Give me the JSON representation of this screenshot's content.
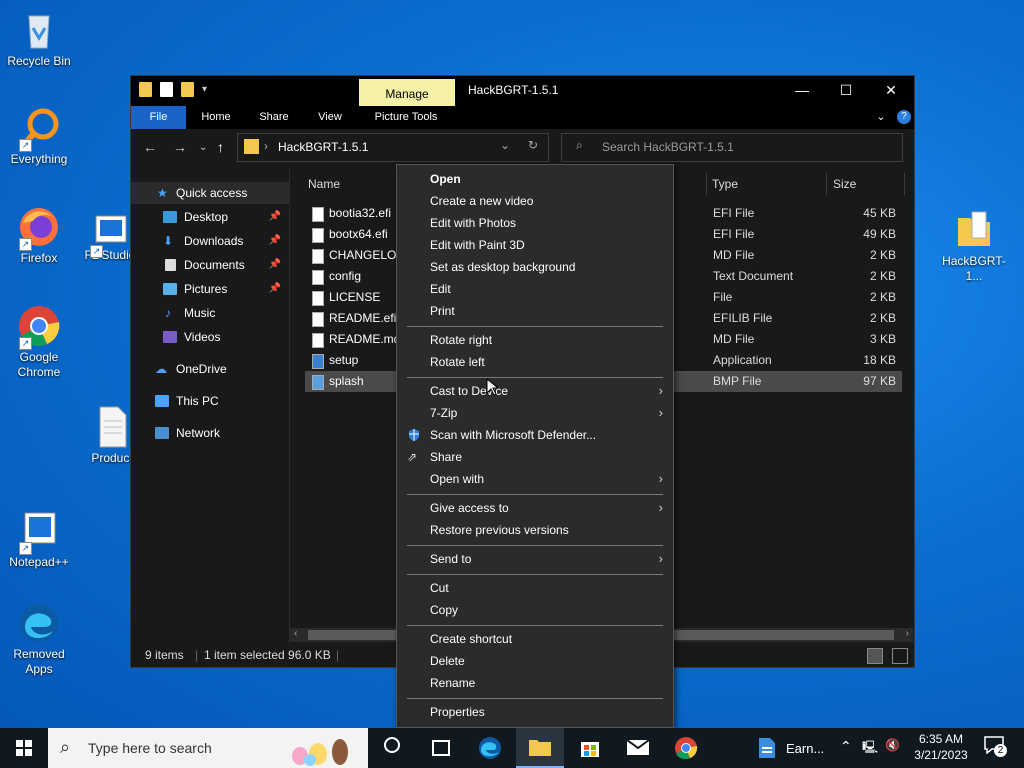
{
  "desktop": {
    "icons": [
      {
        "label": "Recycle Bin"
      },
      {
        "label": "Everything"
      },
      {
        "label": "Firefox"
      },
      {
        "label": "FL Studio"
      },
      {
        "label": "Google Chrome"
      },
      {
        "label": "Product"
      },
      {
        "label": "Notepad++"
      },
      {
        "label": "Removed Apps"
      },
      {
        "label": "HackBGRT-1..."
      }
    ]
  },
  "window": {
    "title": "HackBGRT-1.5.1",
    "manage_tab": "Manage",
    "ribbon_tabs": [
      "File",
      "Home",
      "Share",
      "View",
      "Picture Tools"
    ],
    "address": "HackBGRT-1.5.1",
    "search_placeholder": "Search HackBGRT-1.5.1",
    "controls": {
      "minimize": "—",
      "maximize": "☐",
      "close": "✕"
    }
  },
  "nav": {
    "items": [
      {
        "label": "Quick access"
      },
      {
        "label": "Desktop"
      },
      {
        "label": "Downloads"
      },
      {
        "label": "Documents"
      },
      {
        "label": "Pictures"
      },
      {
        "label": "Music"
      },
      {
        "label": "Videos"
      },
      {
        "label": "OneDrive"
      },
      {
        "label": "This PC"
      },
      {
        "label": "Network"
      }
    ]
  },
  "files": {
    "columns": {
      "name": "Name",
      "type": "Type",
      "size": "Size"
    },
    "rows": [
      {
        "name": "bootia32.efi",
        "type": "EFI File",
        "size": "45 KB"
      },
      {
        "name": "bootx64.efi",
        "type": "EFI File",
        "size": "49 KB"
      },
      {
        "name": "CHANGELOG",
        "type": "MD File",
        "size": "2 KB"
      },
      {
        "name": "config",
        "type": "Text Document",
        "size": "2 KB"
      },
      {
        "name": "LICENSE",
        "type": "File",
        "size": "2 KB"
      },
      {
        "name": "README.efili",
        "type": "EFILIB File",
        "size": "2 KB"
      },
      {
        "name": "README.md",
        "type": "MD File",
        "size": "3 KB"
      },
      {
        "name": "setup",
        "type": "Application",
        "size": "18 KB"
      },
      {
        "name": "splash",
        "type": "BMP File",
        "size": "97 KB"
      }
    ]
  },
  "status": {
    "count": "9 items",
    "selected": "1 item selected  96.0 KB"
  },
  "context_menu": {
    "items": [
      {
        "label": "Open"
      },
      {
        "label": "Create a new video"
      },
      {
        "label": "Edit with Photos"
      },
      {
        "label": "Edit with Paint 3D"
      },
      {
        "label": "Set as desktop background"
      },
      {
        "label": "Edit"
      },
      {
        "label": "Print"
      },
      {
        "label": "Rotate right"
      },
      {
        "label": "Rotate left"
      },
      {
        "label": "Cast to Device"
      },
      {
        "label": "7-Zip"
      },
      {
        "label": "Scan with Microsoft Defender..."
      },
      {
        "label": "Share"
      },
      {
        "label": "Open with"
      },
      {
        "label": "Give access to"
      },
      {
        "label": "Restore previous versions"
      },
      {
        "label": "Send to"
      },
      {
        "label": "Cut"
      },
      {
        "label": "Copy"
      },
      {
        "label": "Create shortcut"
      },
      {
        "label": "Delete"
      },
      {
        "label": "Rename"
      },
      {
        "label": "Properties"
      }
    ]
  },
  "taskbar": {
    "search_placeholder": "Type here to search",
    "earn_label": "Earn...",
    "time": "6:35 AM",
    "date": "3/21/2023",
    "notification_count": "2"
  },
  "colors": {
    "accent": "#1a64c8",
    "manage_tab": "#f5f1a6",
    "folder": "#f2c94c"
  }
}
